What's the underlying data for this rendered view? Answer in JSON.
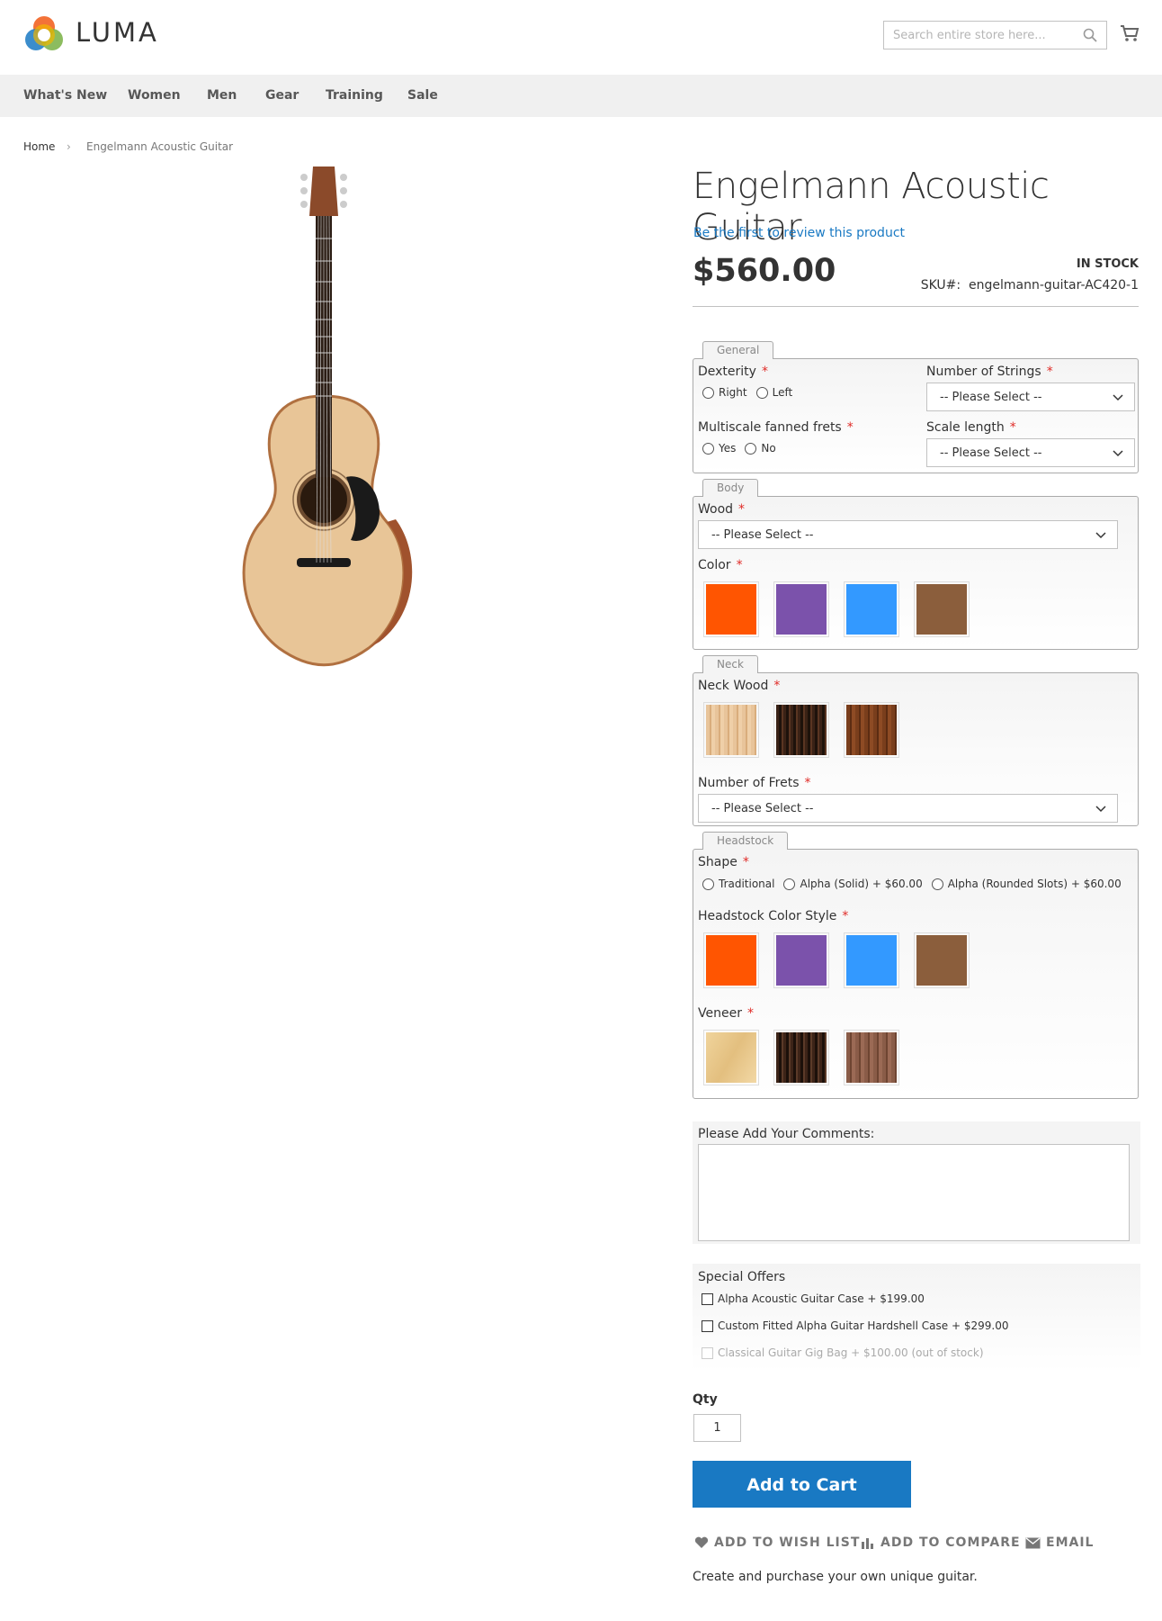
{
  "header": {
    "logo_text": "LUMA",
    "search_placeholder": "Search entire store here..."
  },
  "nav": [
    "What's New",
    "Women",
    "Men",
    "Gear",
    "Training",
    "Sale"
  ],
  "breadcrumb": {
    "home": "Home",
    "separator": "›",
    "current": "Engelmann Acoustic Guitar"
  },
  "product": {
    "title": "Engelmann Acoustic Guitar",
    "review_link": "Be the first to review this product",
    "price": "$560.00",
    "stock": "IN STOCK",
    "sku_label": "SKU#:",
    "sku": "engelmann-guitar-AC420-1",
    "description": "Create and purchase your own unique guitar."
  },
  "general": {
    "legend": "General",
    "dexterity": {
      "label": "Dexterity",
      "options": [
        "Right",
        "Left"
      ]
    },
    "strings": {
      "label": "Number of Strings",
      "value": "-- Please Select --"
    },
    "frets_multi": {
      "label": "Multiscale fanned frets",
      "options": [
        "Yes",
        "No"
      ]
    },
    "scale": {
      "label": "Scale length",
      "value": "-- Please Select --"
    }
  },
  "body": {
    "legend": "Body",
    "wood": {
      "label": "Wood",
      "value": "-- Please Select --"
    },
    "color": {
      "label": "Color",
      "swatches": [
        "#ff5501",
        "#7b52ab",
        "#3399ff",
        "#8b5e3c"
      ]
    }
  },
  "neck": {
    "legend": "Neck",
    "neck_wood": {
      "label": "Neck Wood",
      "swatches": [
        "maple",
        "ebony",
        "rosewood"
      ]
    },
    "frets": {
      "label": "Number of Frets",
      "value": "-- Please Select --"
    }
  },
  "headstock": {
    "legend": "Headstock",
    "shape": {
      "label": "Shape",
      "options": [
        "Traditional",
        "Alpha (Solid) + $60.00",
        "Alpha (Rounded Slots) + $60.00"
      ]
    },
    "color": {
      "label": "Headstock Color Style",
      "swatches": [
        "#ff5501",
        "#7b52ab",
        "#3399ff",
        "#8b5e3c"
      ]
    },
    "veneer": {
      "label": "Veneer",
      "swatches": [
        "spruce",
        "ebony",
        "walnut"
      ]
    }
  },
  "comments": {
    "label": "Please Add Your Comments:"
  },
  "offers": {
    "title": "Special Offers",
    "items": [
      "Alpha Acoustic Guitar Case + $199.00",
      "Custom Fitted Alpha Guitar Hardshell Case + $299.00",
      "Classical Guitar Gig Bag + $100.00 (out of stock)"
    ]
  },
  "qty": {
    "label": "Qty",
    "value": "1"
  },
  "add_to_cart": "Add to Cart",
  "actions": {
    "wishlist": "ADD TO WISH LIST",
    "compare": "ADD TO COMPARE",
    "email": "EMAIL"
  }
}
